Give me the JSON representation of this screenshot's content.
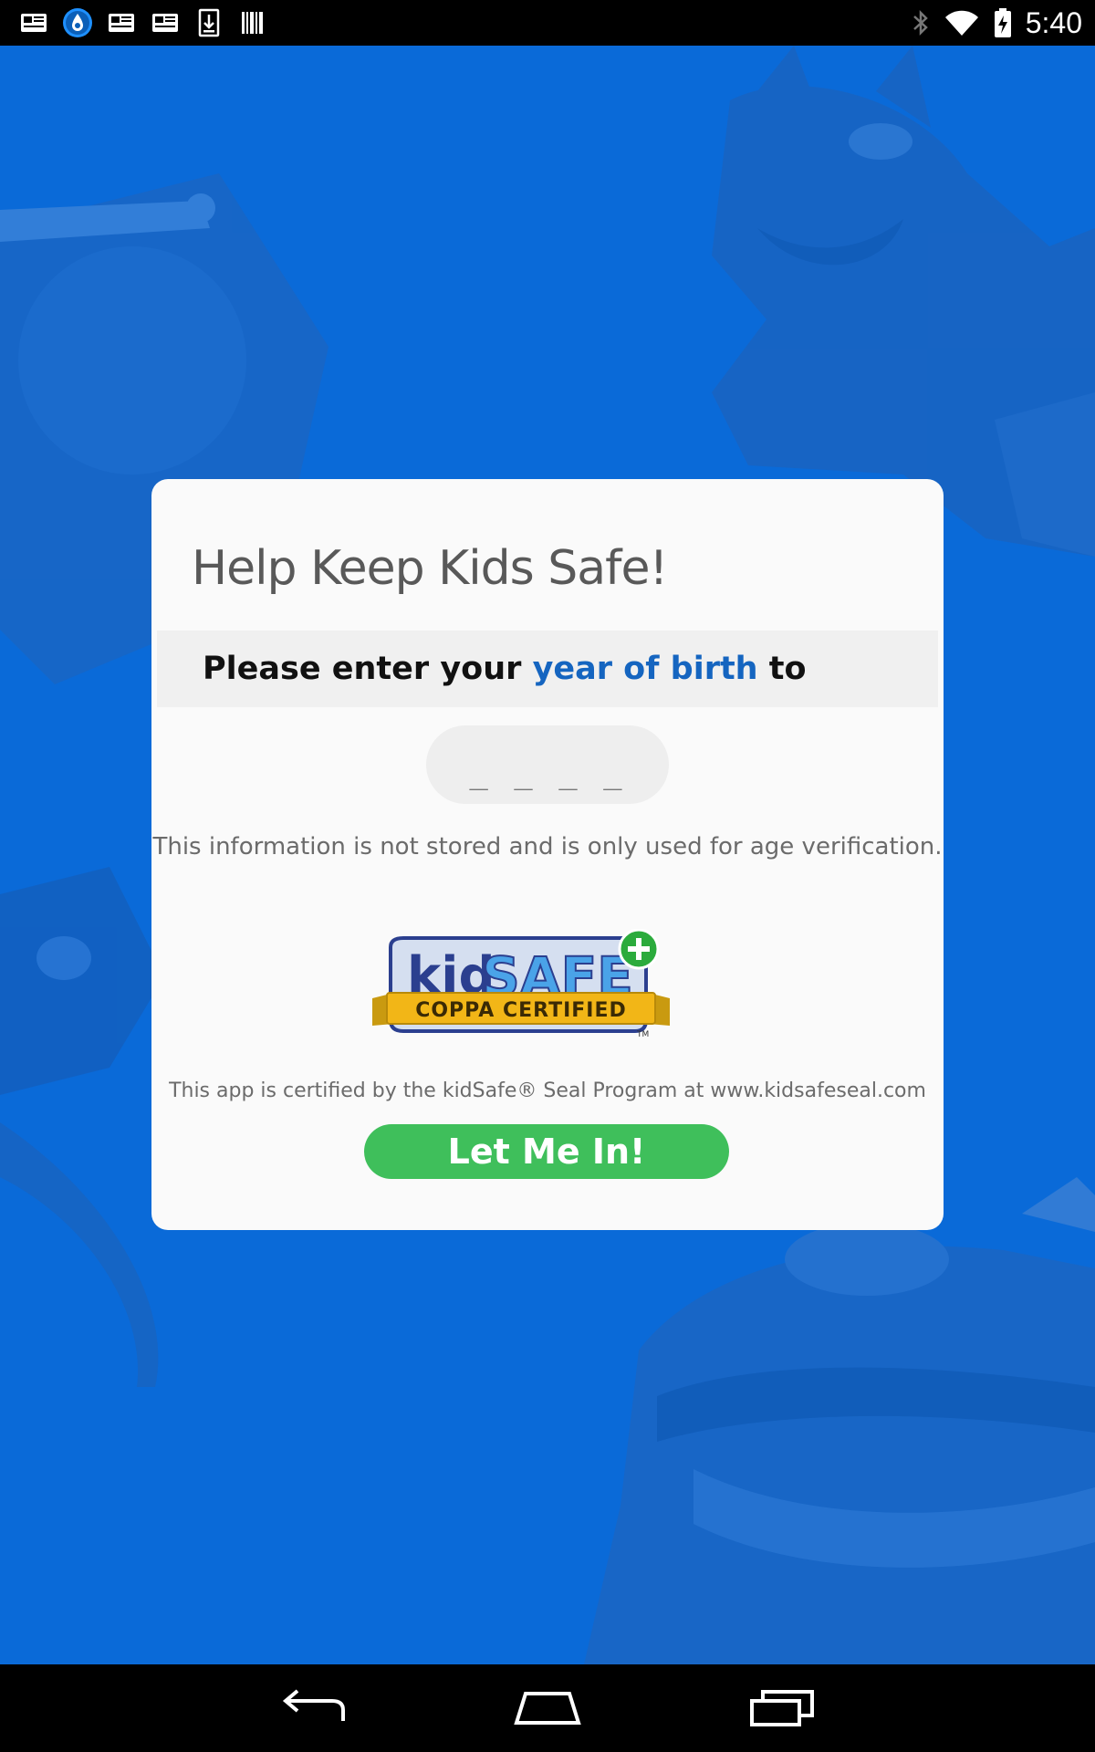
{
  "status_bar": {
    "time": "5:40",
    "notification_icons": [
      "news-icon",
      "water-drop-icon",
      "news-icon",
      "news-icon",
      "download-icon",
      "barcode-icon"
    ],
    "system_icons": [
      "bluetooth-icon",
      "wifi-icon",
      "battery-charging-icon"
    ]
  },
  "dialog": {
    "title": "Help Keep Kids Safe!",
    "prompt": {
      "before": "Please enter your ",
      "highlight": "year of birth",
      "after": " to"
    },
    "year_input": {
      "placeholder": "_ _ _ _",
      "value": ""
    },
    "info_text": "This information is not stored and is only used for age verification.",
    "logo": {
      "name": "kidSAFE COPPA CERTIFIED",
      "word_kid": "kid",
      "word_safe": "SAFE",
      "ribbon": "COPPA CERTIFIED",
      "tm": "TM"
    },
    "certification_text": "This app is certified by the kidSafe® Seal Program at www.kidsafeseal.com",
    "button_label": "Let Me In!"
  },
  "navigation": {
    "buttons": [
      "back-icon",
      "home-icon",
      "recents-icon"
    ]
  },
  "colors": {
    "background": "#0a6ad8",
    "accent_text": "#1565c0",
    "button": "#3fbf5b"
  }
}
